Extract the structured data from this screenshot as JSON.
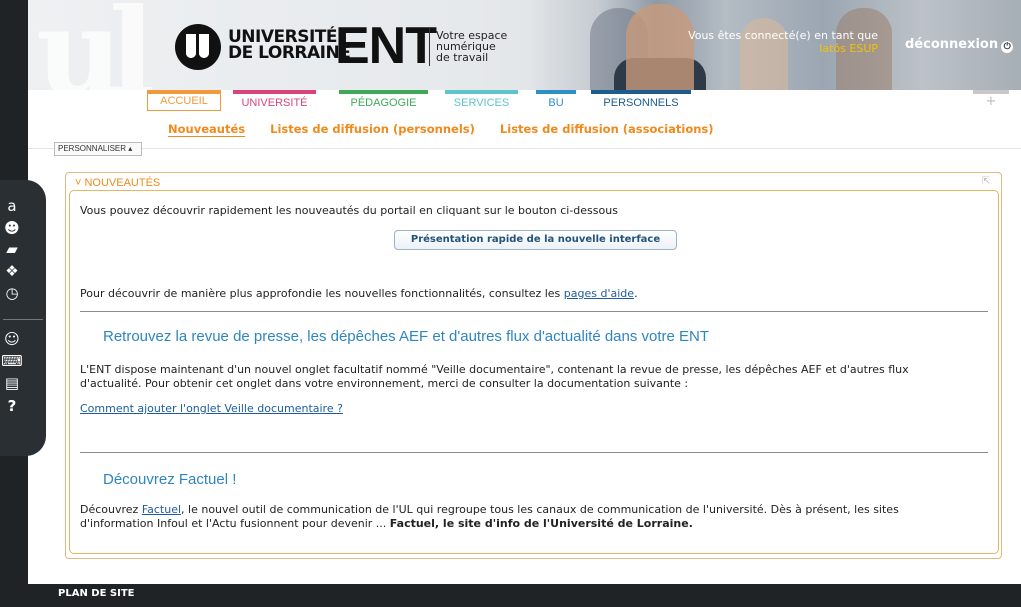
{
  "header": {
    "watermark": "ul",
    "university": [
      "UNIVERSITÉ",
      "DE LORRAINE"
    ],
    "app": "ENT",
    "tagline": [
      "Votre espace",
      "numérique",
      "de travail"
    ],
    "connected_label": "Vous êtes connecté(e) en tant que",
    "connected_user": "Iatôs ESUP",
    "logout": "déconnexion"
  },
  "tabs": [
    {
      "label": "ACCUEIL",
      "color": "#f09a3e",
      "active": true
    },
    {
      "label": "UNIVERSITÉ",
      "color": "#d8447e"
    },
    {
      "label": "PÉDAGOGIE",
      "color": "#3eaa57"
    },
    {
      "label": "SERVICES",
      "color": "#5ec4c9"
    },
    {
      "label": "BU",
      "color": "#2d8fc8"
    },
    {
      "label": "PERSONNELS",
      "color": "#1b5d8e"
    }
  ],
  "tab_plus": "+",
  "subnav": [
    "Nouveautés",
    "Listes de diffusion (personnels)",
    "Listes de diffusion (associations)"
  ],
  "personnaliser": "PERSONNALISER ▴",
  "dock": {
    "icons_top": [
      "amazon-icon",
      "user-icon",
      "card-icon",
      "puzzle-icon",
      "clock-icon"
    ],
    "icons_bottom": [
      "person-icon",
      "laptop-icon",
      "news-icon",
      "help-icon"
    ],
    "glyphs": {
      "amazon-icon": "a",
      "user-icon": "☻",
      "card-icon": "▰",
      "puzzle-icon": "❖",
      "clock-icon": "◷",
      "person-icon": "☺",
      "laptop-icon": "⌨",
      "news-icon": "▤",
      "help-icon": "?"
    }
  },
  "portlet": {
    "title": "˅ NOUVEAUTÉS",
    "intro": "Vous pouvez découvrir rapidement les nouveautés du portail en cliquant sur le bouton ci-dessous",
    "button": "Présentation rapide de la nouvelle interface",
    "help_text": "Pour découvrir de manière plus approfondie les nouvelles fonctionnalités, consultez les",
    "help_link": "pages d'aide",
    "help_end": ".",
    "section1_title": "Retrouvez la revue de presse, les dépêches AEF et d'autres flux d'actualité dans votre ENT",
    "section1_text1": "L'ENT dispose maintenant d'un nouvel onglet facultatif nommé \"Veille documentaire\", contenant la revue de presse, les dépêches AEF et d'autres flux",
    "section1_text2": "d'actualité. Pour obtenir cet onglet dans votre environnement, merci de consulter la documentation suivante :",
    "section1_link": "Comment ajouter l'onglet Veille documentaire ?",
    "section2_title": "Découvrez Factuel !",
    "section2_pre": "Découvrez",
    "section2_link": "Factuel",
    "section2_text1": ", le nouvel outil de communication de l'UL qui regroupe tous les canaux de communication de l'université. Dès à présent, les sites",
    "section2_text2": "d'information Infoul et l'Actu fusionnent pour devenir ...",
    "section2_bold": "Factuel, le site d'info de l'Université de Lorraine."
  },
  "footer": "PLAN DE SITE"
}
